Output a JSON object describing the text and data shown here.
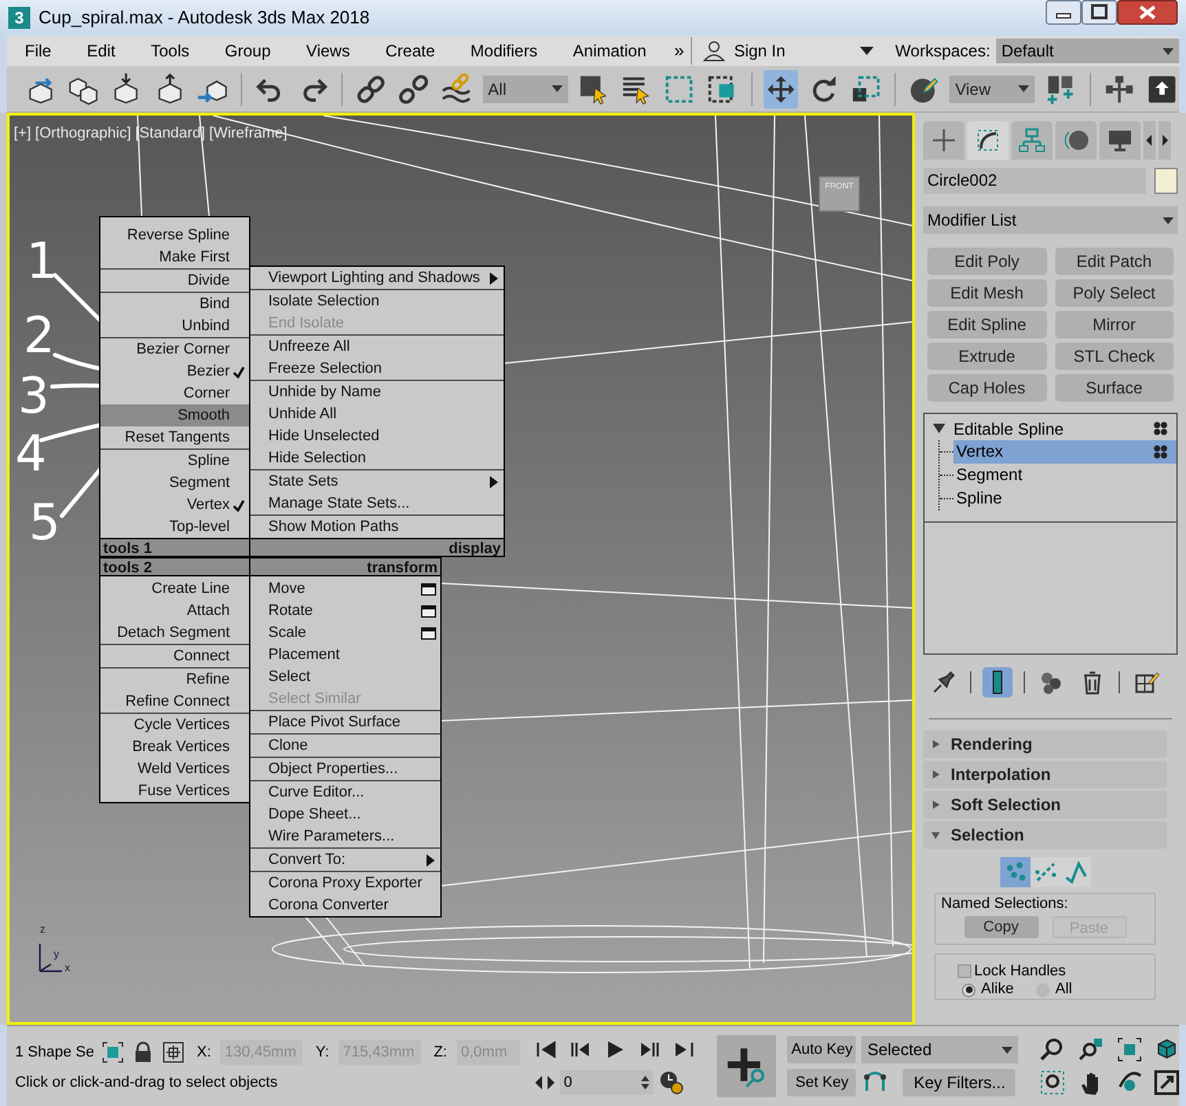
{
  "window": {
    "app_icon": "3",
    "title": "Cup_spiral.max - Autodesk 3ds Max 2018"
  },
  "menu_bar": {
    "items": [
      "File",
      "Edit",
      "Tools",
      "Group",
      "Views",
      "Create",
      "Modifiers",
      "Animation"
    ],
    "overflow": "»",
    "sign_in": "Sign In",
    "workspaces_label": "Workspaces:",
    "workspace": "Default"
  },
  "toolbar": [
    {
      "kind": "link-box",
      "selected": false
    },
    {
      "kind": "boxes",
      "selected": false
    },
    {
      "kind": "box-down",
      "selected": false
    },
    {
      "kind": "box-up",
      "selected": false
    },
    {
      "kind": "box-arrow",
      "selected": false
    },
    {
      "kind": "separator"
    },
    {
      "kind": "undo",
      "selected": false
    },
    {
      "kind": "redo",
      "selected": false
    },
    {
      "kind": "separator"
    },
    {
      "kind": "link",
      "selected": false
    },
    {
      "kind": "unlink",
      "selected": false
    },
    {
      "kind": "wave",
      "selected": false
    },
    {
      "kind": "dropdown",
      "value": "All"
    },
    {
      "kind": "square-cursor",
      "selected": false
    },
    {
      "kind": "list-cursor",
      "selected": false
    },
    {
      "kind": "dashed-rect",
      "selected": false
    },
    {
      "kind": "crossing",
      "selected": false
    },
    {
      "kind": "separator"
    },
    {
      "kind": "move",
      "selected": true
    },
    {
      "kind": "rotate",
      "selected": false
    },
    {
      "kind": "scale",
      "selected": false
    },
    {
      "kind": "separator"
    },
    {
      "kind": "sphere-pencil",
      "selected": false
    },
    {
      "kind": "dropdown",
      "value": "View"
    },
    {
      "kind": "plus-tiles",
      "selected": false
    },
    {
      "kind": "separator"
    },
    {
      "kind": "tree",
      "selected": false
    },
    {
      "kind": "up-box",
      "selected": false
    }
  ],
  "viewport": {
    "labels": [
      "[+]",
      "[Orthographic]",
      "[Standard]",
      "[Wireframe]"
    ],
    "view_cube": "FRONT",
    "axis_labels": [
      "z",
      "y",
      "x"
    ],
    "active": true
  },
  "annotations": [
    {
      "number": "1"
    },
    {
      "number": "2"
    },
    {
      "number": "3"
    },
    {
      "number": "4"
    },
    {
      "number": "5"
    }
  ],
  "quad_menu": {
    "quadrants": [
      {
        "title": "tools 1",
        "groups": [
          [
            {
              "label": "Reverse Spline",
              "checked": false,
              "selected": false
            },
            {
              "label": "Make First",
              "checked": false,
              "selected": false
            }
          ],
          [
            {
              "label": "Divide",
              "checked": false,
              "selected": false
            }
          ],
          [
            {
              "label": "Bind",
              "checked": false,
              "selected": false
            },
            {
              "label": "Unbind",
              "checked": false,
              "selected": false
            }
          ],
          [
            {
              "label": "Bezier Corner",
              "checked": false,
              "selected": false
            },
            {
              "label": "Bezier",
              "checked": true,
              "selected": false
            },
            {
              "label": "Corner",
              "checked": false,
              "selected": false
            },
            {
              "label": "Smooth",
              "checked": false,
              "selected": true
            },
            {
              "label": "Reset Tangents",
              "checked": false,
              "selected": false
            }
          ],
          [
            {
              "label": "Spline",
              "checked": false,
              "selected": false
            },
            {
              "label": "Segment",
              "checked": false,
              "selected": false
            },
            {
              "label": "Vertex",
              "checked": true,
              "selected": false
            },
            {
              "label": "Top-level",
              "checked": false,
              "selected": false
            }
          ]
        ]
      },
      {
        "title": "display",
        "groups": [
          [
            {
              "label": "Viewport Lighting and Shadows",
              "disabled": false,
              "submenu": true
            }
          ],
          [
            {
              "label": "Isolate Selection",
              "disabled": false,
              "submenu": false
            },
            {
              "label": "End Isolate",
              "disabled": true,
              "submenu": false
            }
          ],
          [
            {
              "label": "Unfreeze All",
              "disabled": false,
              "submenu": false
            },
            {
              "label": "Freeze Selection",
              "disabled": false,
              "submenu": false
            }
          ],
          [
            {
              "label": "Unhide by Name",
              "disabled": false,
              "submenu": false
            },
            {
              "label": "Unhide All",
              "disabled": false,
              "submenu": false
            },
            {
              "label": "Hide Unselected",
              "disabled": false,
              "submenu": false
            },
            {
              "label": "Hide Selection",
              "disabled": false,
              "submenu": false
            }
          ],
          [
            {
              "label": "State Sets",
              "disabled": false,
              "submenu": true
            },
            {
              "label": "Manage State Sets...",
              "disabled": false,
              "submenu": false
            }
          ],
          [
            {
              "label": "Show Motion Paths",
              "disabled": false,
              "submenu": false
            }
          ]
        ]
      },
      {
        "title": "tools 2",
        "groups": [
          [
            {
              "label": "Create Line"
            },
            {
              "label": "Attach"
            },
            {
              "label": "Detach Segment"
            }
          ],
          [
            {
              "label": "Connect"
            }
          ],
          [
            {
              "label": "Refine"
            },
            {
              "label": "Refine Connect"
            }
          ],
          [
            {
              "label": "Cycle Vertices"
            },
            {
              "label": "Break Vertices"
            },
            {
              "label": "Weld Vertices"
            },
            {
              "label": "Fuse Vertices"
            }
          ]
        ]
      },
      {
        "title": "transform",
        "groups": [
          [
            {
              "label": "Move",
              "disabled": false,
              "submenu": false,
              "options": true
            },
            {
              "label": "Rotate",
              "disabled": false,
              "submenu": false,
              "options": true
            },
            {
              "label": "Scale",
              "disabled": false,
              "submenu": false,
              "options": true
            },
            {
              "label": "Placement",
              "disabled": false,
              "submenu": false,
              "options": false
            },
            {
              "label": "Select",
              "disabled": false,
              "submenu": false,
              "options": false
            },
            {
              "label": "Select Similar",
              "disabled": true,
              "submenu": false,
              "options": false
            }
          ],
          [
            {
              "label": "Place Pivot Surface",
              "disabled": false,
              "submenu": false,
              "options": false
            }
          ],
          [
            {
              "label": "Clone",
              "disabled": false,
              "submenu": false,
              "options": false
            }
          ],
          [
            {
              "label": "Object Properties...",
              "disabled": false,
              "submenu": false,
              "options": false
            }
          ],
          [
            {
              "label": "Curve Editor...",
              "disabled": false,
              "submenu": false,
              "options": false
            },
            {
              "label": "Dope Sheet...",
              "disabled": false,
              "submenu": false,
              "options": false
            },
            {
              "label": "Wire Parameters...",
              "disabled": false,
              "submenu": false,
              "options": false
            }
          ],
          [
            {
              "label": "Convert To:",
              "disabled": false,
              "submenu": true,
              "options": false
            }
          ],
          [
            {
              "label": "Corona Proxy Exporter",
              "disabled": false,
              "submenu": false,
              "options": false
            },
            {
              "label": "Corona Converter",
              "disabled": false,
              "submenu": false,
              "options": false
            }
          ]
        ]
      }
    ]
  },
  "command_panel": {
    "tabs": [
      {
        "kind": "create",
        "selected": false
      },
      {
        "kind": "modify",
        "selected": true
      },
      {
        "kind": "hierarchy",
        "selected": false
      },
      {
        "kind": "motion",
        "selected": false
      },
      {
        "kind": "display",
        "selected": false
      }
    ],
    "object_name": "Circle002",
    "modifier_list": "Modifier List",
    "modifier_buttons": [
      "Edit Poly",
      "Edit Patch",
      "Edit Mesh",
      "Poly Select",
      "Edit Spline",
      "Mirror",
      "Extrude",
      "STL Check",
      "Cap Holes",
      "Surface"
    ],
    "stack": [
      {
        "label": "Editable Spline",
        "expanded": true,
        "selected": false,
        "children": [
          {
            "label": "Vertex",
            "selected": true
          },
          {
            "label": "Segment",
            "selected": false
          },
          {
            "label": "Spline",
            "selected": false
          }
        ]
      }
    ],
    "stack_tools": [
      {
        "kind": "pin",
        "selected": false
      },
      {
        "kind": "end-result",
        "selected": true
      },
      {
        "kind": "make-unique",
        "selected": false
      },
      {
        "kind": "delete",
        "selected": false
      },
      {
        "kind": "configure",
        "selected": false
      }
    ],
    "rollouts": [
      {
        "title": "Rendering",
        "expanded": false
      },
      {
        "title": "Interpolation",
        "expanded": false
      },
      {
        "title": "Soft Selection",
        "expanded": false
      },
      {
        "title": "Selection",
        "expanded": true
      }
    ],
    "selection": {
      "levels": [
        {
          "kind": "vertex",
          "selected": true
        },
        {
          "kind": "segment",
          "selected": false
        },
        {
          "kind": "spline",
          "selected": false
        }
      ],
      "named_selections": "Named Selections:",
      "copy": {
        "label": "Copy",
        "disabled": false
      },
      "paste": {
        "label": "Paste",
        "disabled": true
      },
      "lock_handles": {
        "label": "Lock Handles",
        "checked": false
      },
      "handle_modes": [
        {
          "label": "Alike",
          "selected": true
        },
        {
          "label": "All",
          "selected": false
        }
      ]
    }
  },
  "status_bar": {
    "selection_count": "1 Shape Se",
    "coords": [
      {
        "label": "X:",
        "value": "130,45mm"
      },
      {
        "label": "Y:",
        "value": "715,43mm"
      },
      {
        "label": "Z:",
        "value": "0,0mm"
      }
    ],
    "coords_disabled": true,
    "prompt": "Click or click-and-drag to select objects",
    "playback": [
      {
        "kind": "to-start"
      },
      {
        "kind": "prev"
      },
      {
        "kind": "play"
      },
      {
        "kind": "next"
      },
      {
        "kind": "to-end"
      }
    ],
    "frame": "0",
    "auto_key": "Auto Key",
    "set_key": "Set Key",
    "key_set": "Selected",
    "key_filters": "Key Filters...",
    "navigation": [
      {
        "kind": "zoom"
      },
      {
        "kind": "zoom-all"
      },
      {
        "kind": "zoom-extents"
      },
      {
        "kind": "zoom-extents-all"
      },
      {
        "kind": "zoom-region"
      },
      {
        "kind": "pan"
      },
      {
        "kind": "orbit"
      },
      {
        "kind": "maximize"
      }
    ]
  }
}
